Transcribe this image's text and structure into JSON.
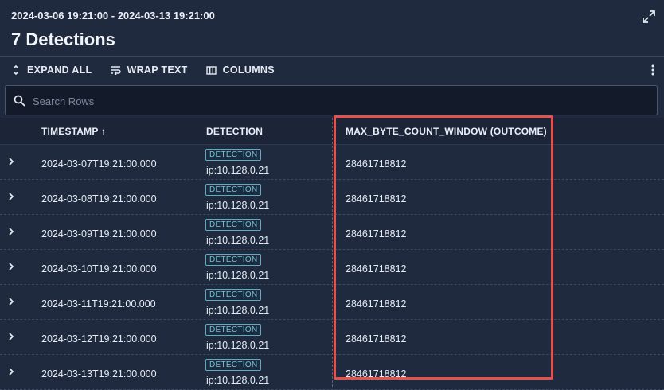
{
  "header": {
    "time_range": "2024-03-06 19:21:00 - 2024-03-13 19:21:00",
    "title": "7 Detections"
  },
  "toolbar": {
    "expand_all": "EXPAND ALL",
    "wrap_text": "WRAP TEXT",
    "columns": "COLUMNS"
  },
  "search": {
    "placeholder": "Search Rows"
  },
  "table": {
    "columns": [
      "TIMESTAMP ↑",
      "DETECTION",
      "MAX_BYTE_COUNT_WINDOW (OUTCOME)"
    ],
    "rows": [
      {
        "timestamp": "2024-03-07T19:21:00.000",
        "badge": "DETECTION",
        "ip": "ip:10.128.0.21",
        "value": "28461718812"
      },
      {
        "timestamp": "2024-03-08T19:21:00.000",
        "badge": "DETECTION",
        "ip": "ip:10.128.0.21",
        "value": "28461718812"
      },
      {
        "timestamp": "2024-03-09T19:21:00.000",
        "badge": "DETECTION",
        "ip": "ip:10.128.0.21",
        "value": "28461718812"
      },
      {
        "timestamp": "2024-03-10T19:21:00.000",
        "badge": "DETECTION",
        "ip": "ip:10.128.0.21",
        "value": "28461718812"
      },
      {
        "timestamp": "2024-03-11T19:21:00.000",
        "badge": "DETECTION",
        "ip": "ip:10.128.0.21",
        "value": "28461718812"
      },
      {
        "timestamp": "2024-03-12T19:21:00.000",
        "badge": "DETECTION",
        "ip": "ip:10.128.0.21",
        "value": "28461718812"
      },
      {
        "timestamp": "2024-03-13T19:21:00.000",
        "badge": "DETECTION",
        "ip": "ip:10.128.0.21",
        "value": "28461718812"
      }
    ]
  },
  "colors": {
    "background": "#1f2a3e",
    "badge": "#6fc3d6",
    "highlight": "#e5524c"
  },
  "icons": [
    "expand-icon",
    "chevrons-updown-icon",
    "wrap-text-icon",
    "columns-icon",
    "kebab-menu-icon",
    "search-icon",
    "chevron-right-icon"
  ]
}
